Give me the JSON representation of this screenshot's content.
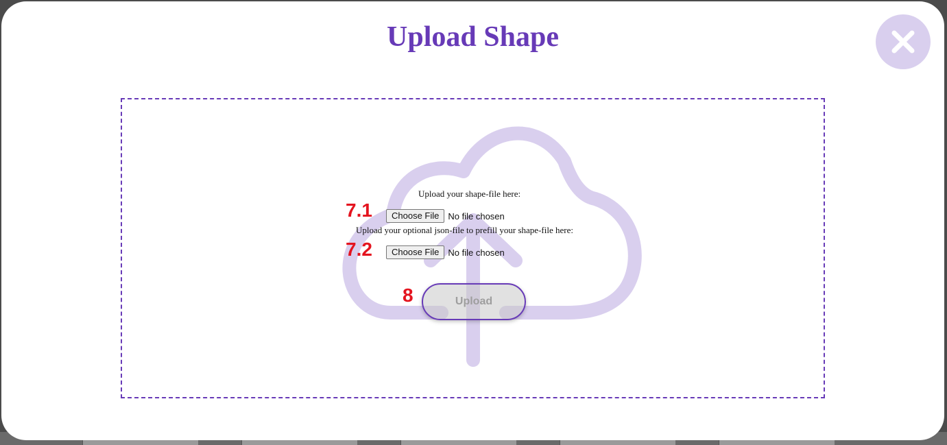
{
  "dialog": {
    "title": "Upload Shape",
    "close_icon": "close-x-icon"
  },
  "drop_zone": {
    "background_icon": "cloud-upload-icon",
    "shape_file": {
      "label": "Upload your shape-file here:",
      "button_label": "Choose File",
      "status": "No file chosen"
    },
    "json_file": {
      "label": "Upload your optional json-file to prefill your shape-file here:",
      "button_label": "Choose File",
      "status": "No file chosen"
    },
    "upload_button_label": "Upload"
  },
  "annotations": {
    "shape_file_marker": "7.1",
    "json_file_marker": "7.2",
    "upload_marker": "8"
  },
  "colors": {
    "accent": "#673ab7",
    "icon_tint": "#d9cfee",
    "annotation": "#e4141f"
  }
}
